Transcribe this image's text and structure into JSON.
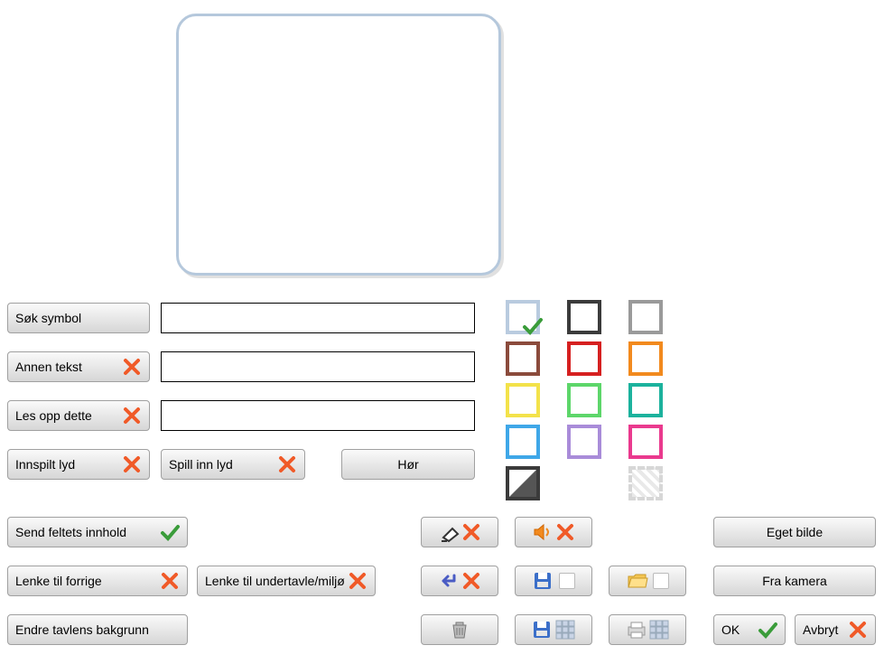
{
  "row_buttons": {
    "search_symbol": "Søk symbol",
    "other_text": "Annen tekst",
    "read_this": "Les opp dette",
    "recorded_sound": "Innspilt lyd",
    "record_sound": "Spill inn lyd",
    "listen": "Hør"
  },
  "swatches": {
    "row1": [
      {
        "fill": "#ffffff",
        "border": "#b9cbdf",
        "checked": true
      },
      {
        "fill": "#ffffff",
        "border": "#3b3b3b"
      },
      {
        "fill": "#ffffff",
        "border": "#9a9a9a"
      }
    ],
    "row2": [
      {
        "fill": "#ffffff",
        "border": "#8b4b3c"
      },
      {
        "fill": "#ffffff",
        "border": "#d62020"
      },
      {
        "fill": "#ffffff",
        "border": "#f28a1e"
      }
    ],
    "row3": [
      {
        "fill": "#ffffff",
        "border": "#f3e24a"
      },
      {
        "fill": "#ffffff",
        "border": "#5dd66a"
      },
      {
        "fill": "#ffffff",
        "border": "#1cb29d"
      }
    ],
    "row4": [
      {
        "fill": "#ffffff",
        "border": "#3fa7e8"
      },
      {
        "fill": "#ffffff",
        "border": "#a98cd9"
      },
      {
        "fill": "#ffffff",
        "border": "#ea3a8e"
      }
    ],
    "row5": [
      {
        "fill": "linear-gradient(135deg,#fff 50%,#555 50%)",
        "border": "#3b3b3b"
      },
      null,
      {
        "transparent": true,
        "border": "#cfcfcf"
      }
    ]
  },
  "bottom_left": {
    "send_content": "Send feltets innhold",
    "link_prev": "Lenke til forrige",
    "link_sub": "Lenke til undertavle/miljø",
    "change_bg": "Endre tavlens bakgrunn"
  },
  "bottom_right": {
    "own_image": "Eget bilde",
    "from_camera": "Fra kamera",
    "ok": "OK",
    "cancel": "Avbryt"
  }
}
